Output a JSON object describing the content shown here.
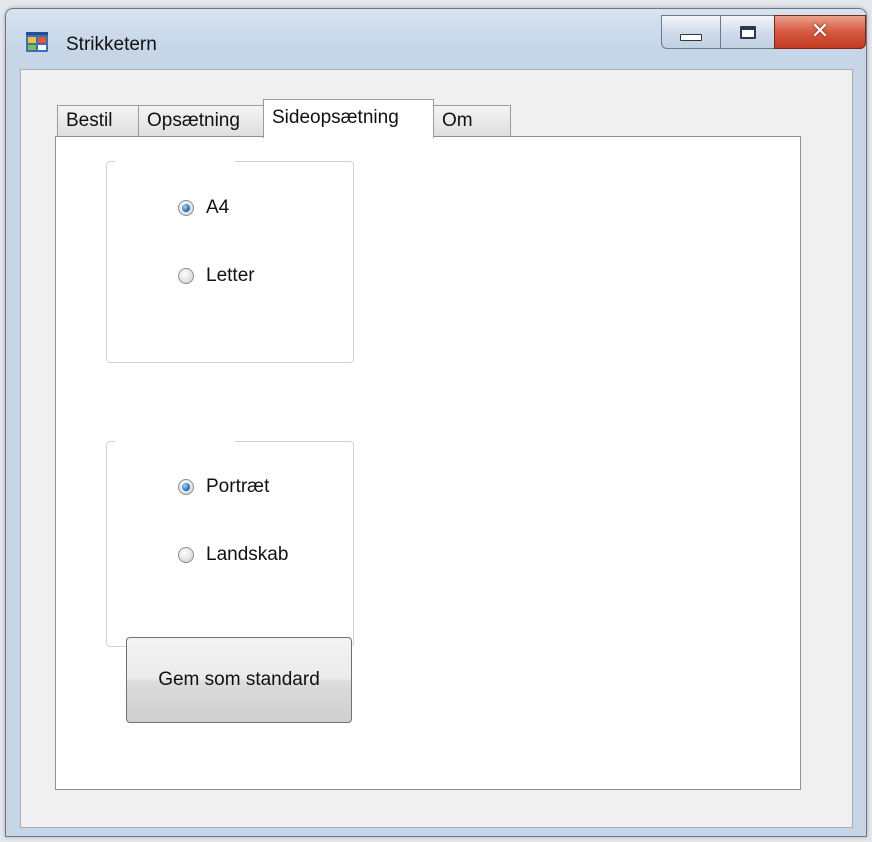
{
  "window": {
    "title": "Strikketern",
    "icons": {
      "app": "app-window-icon",
      "minimize": "minimize-icon",
      "maximize": "maximize-icon",
      "close": "close-icon"
    }
  },
  "tabs": [
    {
      "label": "Bestil"
    },
    {
      "label": "Opsætning"
    },
    {
      "label": "Sideopsætning",
      "active": true
    },
    {
      "label": "Om"
    }
  ],
  "paper_size": {
    "options": [
      {
        "label": "A4",
        "checked": true
      },
      {
        "label": "Letter",
        "checked": false
      }
    ]
  },
  "orientation": {
    "options": [
      {
        "label": "Portræt",
        "checked": true
      },
      {
        "label": "Landskab",
        "checked": false
      }
    ]
  },
  "save_button": {
    "label": "Gem som standard"
  },
  "colors": {
    "radio_selected": "#1c5fae",
    "close_button": "#c23a20",
    "panel_background": "#ffffff"
  }
}
